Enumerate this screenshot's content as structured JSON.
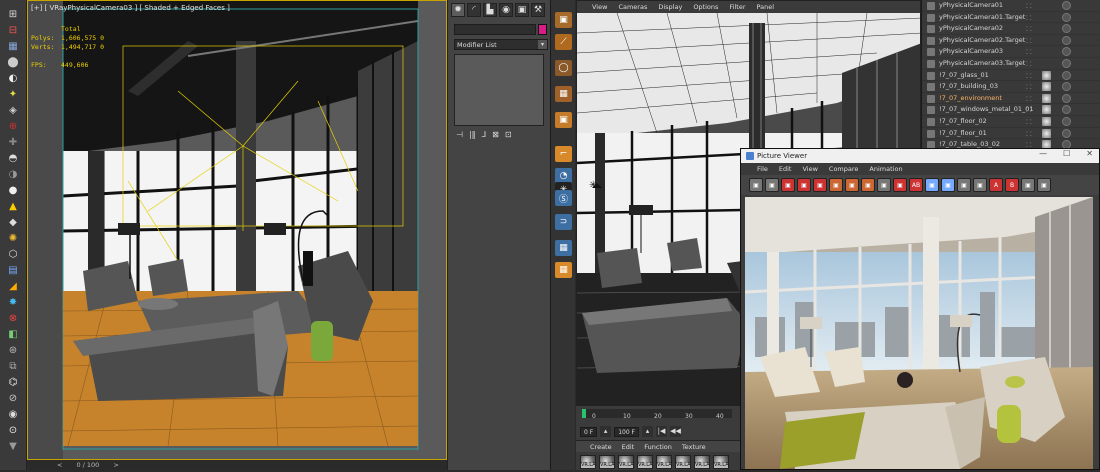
{
  "max": {
    "viewport": {
      "label": "[+] [ VRayPhysicalCamera03 ] [ Shaded + Edged Faces ]",
      "stats": [
        {
          "key": "",
          "value": "Total"
        },
        {
          "key": "Polys:",
          "value": "1,606,575  0"
        },
        {
          "key": "Verts:",
          "value": "1,494,717  0"
        },
        {
          "key": "",
          "value": ""
        },
        {
          "key": "FPS:",
          "value": "449,606"
        }
      ]
    },
    "statusbar": {
      "frame": "0 / 100",
      "arrow_left": "<",
      "arrow_right": ">"
    },
    "command_panel": {
      "tabs": [
        "✹",
        "◜",
        "▙",
        "◉",
        "▣",
        "⚒"
      ],
      "modifier_list": "Modifier List",
      "modifier_arrow": "▾",
      "stack_tools": [
        "⊣",
        "|‖",
        "⅃",
        "⊠",
        "⊡"
      ]
    },
    "left_toolbar_icons": [
      "⊞",
      "⊟",
      "▦",
      "⬤",
      "◐",
      "✦",
      "◈",
      "⊕",
      "✚",
      "◓",
      "◑",
      "●",
      "▲",
      "◆",
      "✺",
      "⬡",
      "▤",
      "◢",
      "✸",
      "⊗",
      "◧",
      "⊛",
      "⧉",
      "⌬",
      "⊘",
      "◉",
      "⊙",
      "▼"
    ]
  },
  "c4d": {
    "viewport_menu": [
      "View",
      "Cameras",
      "Display",
      "Options",
      "Filter",
      "Panel"
    ],
    "nav_icons": [
      "✥",
      "⊕",
      "⟲",
      "▣"
    ],
    "left_toolbar_icons": [
      "▣",
      "⟋",
      "◯",
      "▦",
      "▣",
      "⌐",
      "◔",
      "✳",
      "Ⓢ",
      "⊃",
      "▦",
      "▦"
    ],
    "timeline": {
      "ticks": [
        "0",
        "10",
        "20",
        "30",
        "40"
      ],
      "start_field": "0 F",
      "end_field": "100 F",
      "buttons": [
        "|◀",
        "◀◀"
      ]
    },
    "material_manager": {
      "menu": [
        "Create",
        "Edit",
        "Function",
        "Texture"
      ],
      "swatches": [
        "VR.LA",
        "VR.LA",
        "VR.LA",
        "VR.LA",
        "VR.LA",
        "VR.LA",
        "VR.LA",
        "VR.LA"
      ]
    },
    "object_manager": {
      "rows": [
        {
          "name": "yPhysicalCamera01",
          "selected": false
        },
        {
          "name": "yPhysicalCamera01.Target",
          "selected": false
        },
        {
          "name": "yPhysicalCamera02",
          "selected": false
        },
        {
          "name": "yPhysicalCamera02.Target",
          "selected": false
        },
        {
          "name": "yPhysicalCamera03",
          "selected": false
        },
        {
          "name": "yPhysicalCamera03.Target",
          "selected": false
        },
        {
          "name": "!7_07_glass_01",
          "selected": false
        },
        {
          "name": "!7_07_building_03",
          "selected": false
        },
        {
          "name": "!7_07_environment",
          "selected": true
        },
        {
          "name": "!7_07_windows_metal_01_01",
          "selected": false
        },
        {
          "name": "!7_07_floor_02",
          "selected": false
        },
        {
          "name": "!7_07_floor_01",
          "selected": false
        },
        {
          "name": "!7_07_table_03_02",
          "selected": false
        }
      ],
      "row_dots": "⁚ ⁚"
    },
    "picture_viewer": {
      "title": "Picture Viewer",
      "window_buttons": [
        "—",
        "☐",
        "✕"
      ],
      "menu": [
        "File",
        "Edit",
        "View",
        "Compare",
        "Animation"
      ],
      "toolbar": [
        "▣",
        "▣",
        "▣",
        "▣",
        "▣",
        "▣",
        "▣",
        "▣",
        "▣",
        "▣",
        "AB",
        "▣",
        "▣",
        "▣",
        "▣",
        "A",
        "B",
        "▣",
        "▣"
      ]
    }
  }
}
